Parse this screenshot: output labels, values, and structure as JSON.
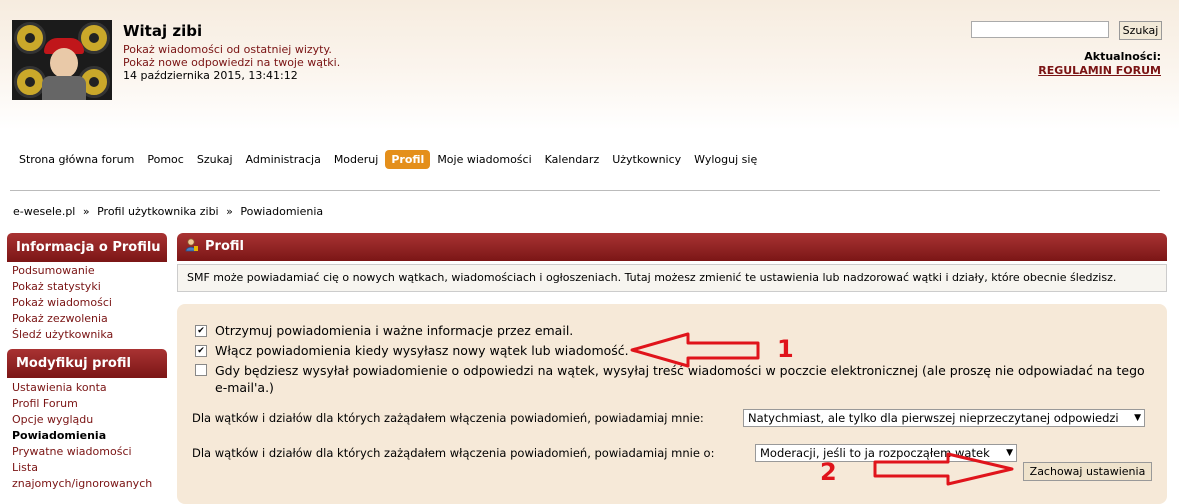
{
  "header": {
    "welcome": "Witaj zibi",
    "lines": [
      "Pokaż wiadomości od ostatniej wizyty.",
      "Pokaż nowe odpowiedzi na twoje wątki.",
      "14 października 2015, 13:41:12"
    ],
    "search_placeholder": "",
    "search_button": "Szukaj",
    "news_label": "Aktualności:",
    "news_link": "REGULAMIN FORUM"
  },
  "nav": {
    "items": [
      "Strona główna forum",
      "Pomoc",
      "Szukaj",
      "Administracja",
      "Moderuj",
      "Profil",
      "Moje wiadomości",
      "Kalendarz",
      "Użytkownicy",
      "Wyloguj się"
    ],
    "active": "Profil"
  },
  "breadcrumb": [
    "e-wesele.pl",
    "Profil użytkownika zibi",
    "Powiadomienia"
  ],
  "breadcrumb_sep": "»",
  "sidebar": {
    "info_title": "Informacja o Profilu",
    "info_items": [
      "Podsumowanie",
      "Pokaż statystyki",
      "Pokaż wiadomości",
      "Pokaż zezwolenia",
      "Śledź użytkownika"
    ],
    "modify_title": "Modyfikuj profil",
    "modify_items": [
      "Ustawienia konta",
      "Profil Forum",
      "Opcje wyglądu",
      "Powiadomienia",
      "Prywatne wiadomości",
      "Lista",
      "znajomych/ignorowanych"
    ],
    "current": "Powiadomienia"
  },
  "main": {
    "title": "Profil",
    "description": "SMF może powiadamiać cię o nowych wątkach, wiadomościach i ogłoszeniach. Tutaj możesz zmienić te ustawienia lub nadzorować wątki i działy, które obecnie śledzisz.",
    "checkboxes": [
      {
        "label": "Otrzymuj powiadomienia i ważne informacje przez email.",
        "checked": true
      },
      {
        "label": "Włącz powiadomienia kiedy wysyłasz nowy wątek lub wiadomość.",
        "checked": true
      },
      {
        "label": "Gdy będziesz wysyłał powiadomienie o odpowiedzi na wątek, wysyłaj treść wiadomości w poczcie elektronicznej (ale proszę nie odpowiadać na tego e-mail'a.)",
        "checked": false
      }
    ],
    "pref1_label": "Dla wątków i działów dla których zażądałem włączenia powiadomień, powiadamiaj mnie:",
    "pref1_value": "Natychmiast, ale tylko dla pierwszej nieprzeczytanej odpowiedzi",
    "pref2_label": "Dla wątków i działów dla których zażądałem włączenia powiadomień, powiadamiaj mnie o:",
    "pref2_value": "Moderacji, jeśli to ja rozpocząłem wątek",
    "save_button": "Zachowaj ustawienia"
  },
  "annotations": {
    "n1": "1",
    "n2": "2",
    "color": "#e0141b"
  }
}
